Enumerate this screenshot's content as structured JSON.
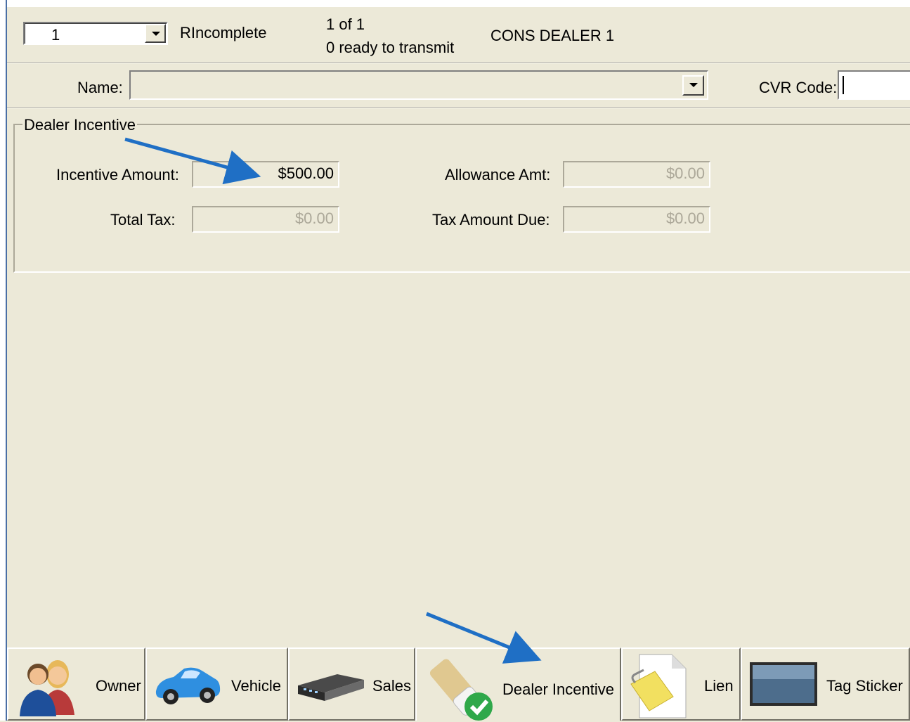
{
  "header": {
    "record_number": "1",
    "status": "RIncomplete",
    "position": "1 of 1",
    "ready_text": "0 ready to transmit",
    "dealer": "CONS DEALER 1"
  },
  "name_row": {
    "name_label": "Name:",
    "name_value": "",
    "cvr_label": "CVR Code:",
    "cvr_value": ""
  },
  "dealer_incentive": {
    "group_title": "Dealer Incentive",
    "incentive_amount_label": "Incentive Amount:",
    "incentive_amount": "$500.00",
    "allowance_label": "Allowance Amt:",
    "allowance_amount": "$0.00",
    "total_tax_label": "Total Tax:",
    "total_tax": "$0.00",
    "tax_due_label": "Tax Amount Due:",
    "tax_due": "$0.00"
  },
  "tabs": [
    {
      "label": "Owner",
      "icon": "owner-people-icon"
    },
    {
      "label": "Vehicle",
      "icon": "car-icon"
    },
    {
      "label": "Sales",
      "icon": "network-switch-icon"
    },
    {
      "label": "Dealer Incentive",
      "icon": "eraser-check-icon",
      "active": true
    },
    {
      "label": "Lien",
      "icon": "document-clip-icon"
    },
    {
      "label": "Tag Sticker",
      "icon": "sticker-panel-icon"
    }
  ],
  "colors": {
    "background": "#ece9d8",
    "annotation_arrow": "#1f6fc5"
  }
}
